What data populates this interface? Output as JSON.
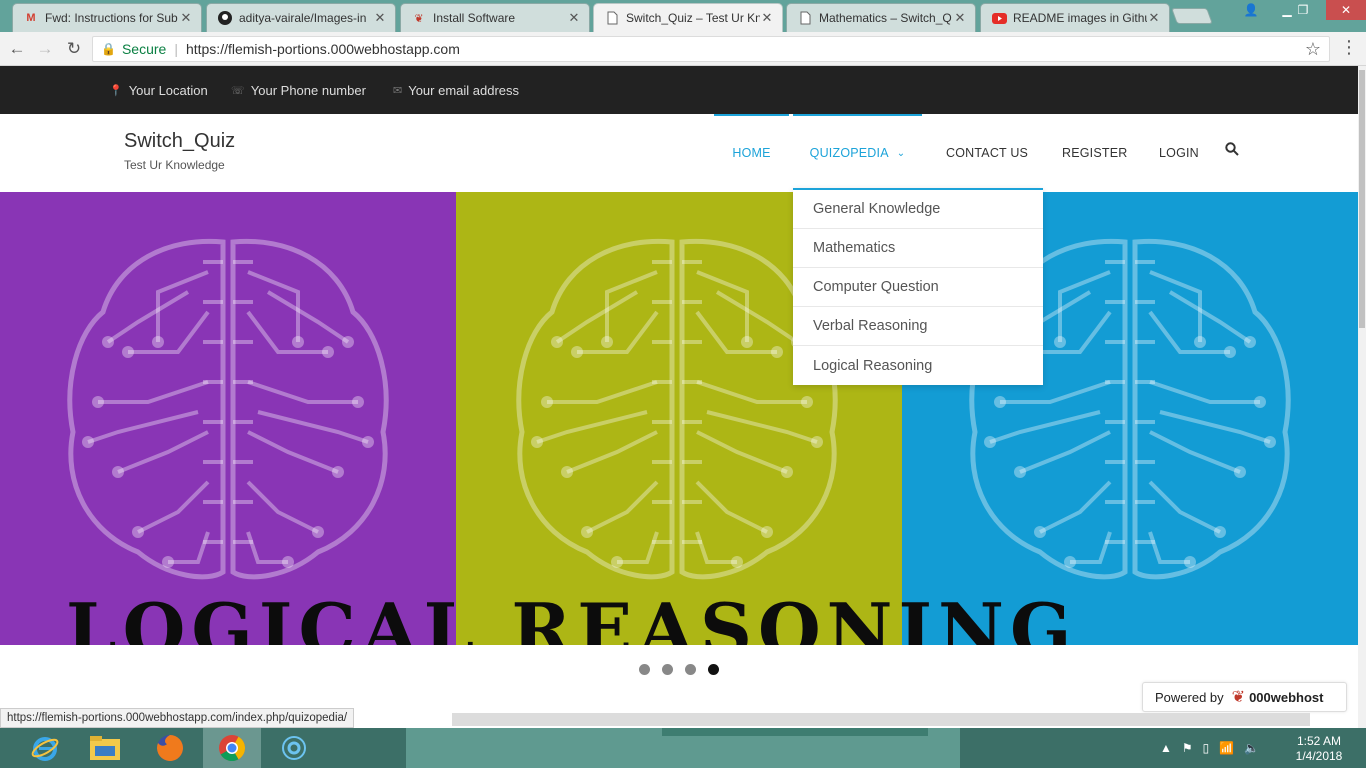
{
  "browser": {
    "tabs": [
      {
        "title": "Fwd: Instructions for Sub",
        "icon": "gmail-icon",
        "active": false
      },
      {
        "title": "aditya-vairale/Images-in",
        "icon": "github-icon",
        "active": false
      },
      {
        "title": "Install Software",
        "icon": "000webhost-icon",
        "active": false
      },
      {
        "title": "Switch_Quiz – Test Ur Kn",
        "icon": "page-icon",
        "active": true
      },
      {
        "title": "Mathematics – Switch_Q",
        "icon": "page-icon",
        "active": false
      },
      {
        "title": "README images in Githu",
        "icon": "youtube-icon",
        "active": false
      }
    ],
    "secure_label": "Secure",
    "url": "https://flemish-portions.000webhostapp.com",
    "status_url": "https://flemish-portions.000webhostapp.com/index.php/quizopedia/"
  },
  "topbar": {
    "location": "Your Location",
    "phone": "Your Phone number",
    "email": "Your email address"
  },
  "site": {
    "title": "Switch_Quiz",
    "tagline": "Test Ur Knowledge"
  },
  "nav": {
    "home": "HOME",
    "quizopedia": "QUIZOPEDIA",
    "contact": "CONTACT US",
    "register": "REGISTER",
    "login": "LOGIN"
  },
  "dropdown": [
    "General Knowledge",
    "Mathematics",
    "Computer Question",
    "Verbal Reasoning",
    "Logical Reasoning"
  ],
  "slider": {
    "text": "LOGICAL REASONING",
    "colors": [
      "#8935b5",
      "#adb615",
      "#139cd4"
    ],
    "active_dot": 4,
    "dot_count": 4
  },
  "powered": {
    "label": "Powered by",
    "brand": "000webhost"
  },
  "clock": {
    "time": "1:52 AM",
    "date": "1/4/2018"
  }
}
